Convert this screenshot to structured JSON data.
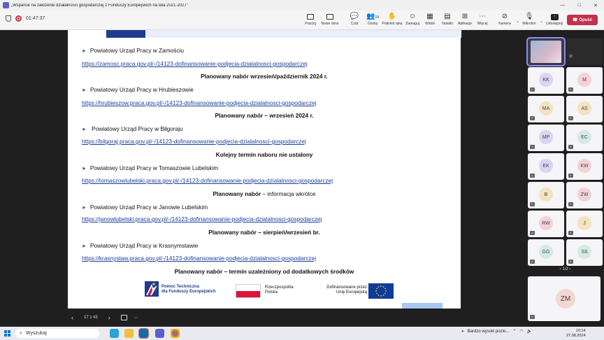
{
  "window": {
    "title": "„Wsparcie na założenie działalności gospodarczej z Funduszy Europejskich na lata 2021-2027”",
    "controls": [
      "—",
      "□",
      "✕"
    ]
  },
  "meeting": {
    "timer": "01:47:37",
    "toolbar": [
      {
        "label": "Prac|nj",
        "icon": "screen-icon"
      },
      {
        "label": "Nowe okno",
        "icon": "window-icon"
      },
      {
        "label": "Czat",
        "icon": "chat-icon"
      },
      {
        "label": "Osoby",
        "icon": "people-icon",
        "count": "19"
      },
      {
        "label": "Podnieś rękę",
        "icon": "hand-icon"
      },
      {
        "label": "Zareaguj",
        "icon": "emoji-icon"
      },
      {
        "label": "Widok",
        "icon": "grid-icon"
      },
      {
        "label": "Notatki",
        "icon": "notes-icon"
      },
      {
        "label": "Aplikacje",
        "icon": "apps-icon"
      },
      {
        "label": "Więcej",
        "icon": "more-icon"
      },
      {
        "label": "Kamera",
        "icon": "camera-off-icon"
      },
      {
        "label": "Mikrofon",
        "icon": "mic-off-icon"
      },
      {
        "label": "Udostępnij",
        "icon": "share-icon"
      }
    ],
    "leave_label": "Opuść"
  },
  "slide": {
    "entries": [
      {
        "office": "Powiatowy Urząd Pracy w Zamościu",
        "link": "https://zamosc.praca.gov.pl/-/14123-dofinansowanie-podjecia-dzialalnosci-gospodarczej",
        "plan_bold": "Planowany nabór wrzesień/październik 2024 r.",
        "plan_normal": ""
      },
      {
        "office": "Powiatowy Urząd Pracy w Hrubieszowie",
        "link": "https://hrubieszow.praca.gov.pl/-/14123-dofinansowanie-podjecia-dzialalnosci-gospodarczej",
        "plan_bold": "Planowany nabór – wrzesień 2024 r.",
        "plan_normal": ""
      },
      {
        "office": " Powiatowy Urząd Pracy w Biłgoraju",
        "link": "https://bilgoraj.praca.gov.pl/-/14123-dofinansowanie-podjecia-dzialalnosci-gospodarczej",
        "plan_bold": "Kolejny termin naboru nie ustalony",
        "plan_normal": ""
      },
      {
        "office": "Powiatowy Urząd Pracy w Tomaszowie Lubelskim",
        "link": "https://tomaszowlubelski.praca.gov.pl/-/14123-dofinansowanie-podjecia-dzialalnosci-gospodarczej",
        "plan_bold": "Planowany nabór",
        "plan_normal": " – informacja wkrótce"
      },
      {
        "office": "Powiatowy Urząd Pracy w Janowie Lubelskim",
        "link": "https://janowlubelski.praca.gov.pl/-/14123-dofinansowanie-podjecia-dzialalnosci-gospodarczej",
        "plan_bold": "Planowany nabór – sierpień/wrzesień br.",
        "plan_normal": ""
      },
      {
        "office": "Powiatowy Urząd Pracy w Krasnymstawie",
        "link": "https://krasnystaw.praca.gov.pl/-/14123-dofinansowanie-podjecia-dzialalnosci-gospodarczej",
        "plan_bold": "Planowany nabór – termin uzależniony od dodatkowych środków",
        "plan_normal": ""
      }
    ],
    "bullet": "➤",
    "logos": {
      "fe_line1": "Pomoc Techniczna",
      "fe_line2": "dla Funduszy Europejskich",
      "pl_line1": "Rzeczpospolita",
      "pl_line2": "Polska",
      "eu_line1": "Dofinansowane przez",
      "eu_line2": "Unię Europejską"
    }
  },
  "slide_nav": {
    "page": "17 z 43"
  },
  "participants": {
    "tiles": [
      "KK",
      "M",
      "MA",
      "AS",
      "MP",
      "EC",
      "EK",
      "KW",
      "B",
      "ZW",
      "RW",
      "J",
      "GG",
      "SS"
    ],
    "colors": [
      "#d9d4f2",
      "#f3d3d8",
      "#f3e3c0",
      "#f3e3c0",
      "#d9d4f2",
      "#d4ebe4",
      "#d9d4f2",
      "#f3d3d8",
      "#f3e3c0",
      "#f3d3d8",
      "#f3d3d8",
      "#f3e3c0",
      "#d4ebe4",
      "#d4ebe4"
    ],
    "pager": "1/2",
    "big_tile": "ZM"
  },
  "taskbar": {
    "search_placeholder": "Wyszukaj",
    "tray_text": "Bardzo wysoki pozio...",
    "time": "10:14",
    "date": "27.08.2024"
  }
}
